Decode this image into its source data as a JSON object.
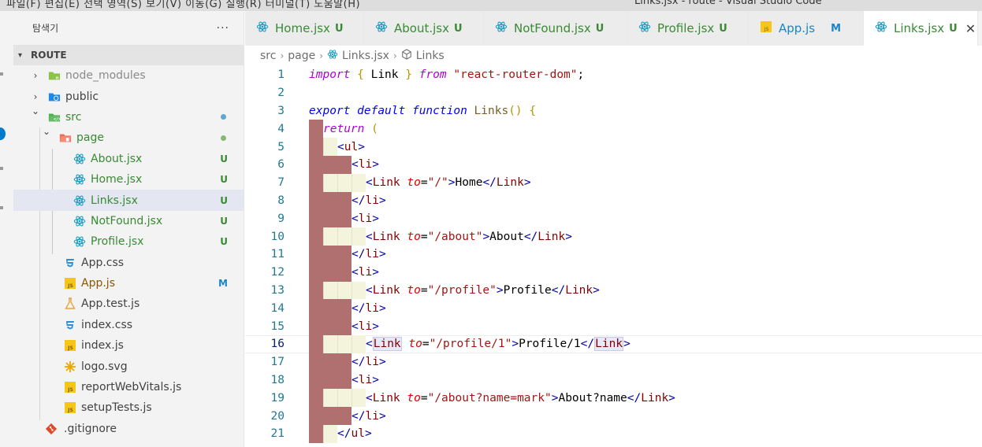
{
  "menubar": {
    "items_text": "파일(F)   편집(E)   선택 영역(S)   보기(V)   이동(G)   실행(R)   터미널(T)   도움말(H)",
    "window_title": "Links.jsx - route - Visual Studio Code"
  },
  "sidebar": {
    "title": "탐색기",
    "more": "···",
    "section": "ROUTE",
    "tree": [
      {
        "label": "node_modules",
        "depth": 1,
        "kind": "folder",
        "chevron": "›",
        "icon": "folder-node",
        "color": "gray"
      },
      {
        "label": "public",
        "depth": 1,
        "kind": "folder",
        "chevron": "›",
        "icon": "folder-public",
        "color": "default"
      },
      {
        "label": "src",
        "depth": 1,
        "kind": "folder-open",
        "chevron": "⌄",
        "icon": "folder-src",
        "color": "green",
        "badge_dot": "#5fa8d3"
      },
      {
        "label": "page",
        "depth": 2,
        "kind": "folder-open",
        "chevron": "⌄",
        "icon": "folder-page",
        "color": "green",
        "badge_dot": "#88b86f"
      },
      {
        "label": "About.jsx",
        "depth": 3,
        "kind": "file",
        "icon": "react",
        "color": "green",
        "badge": "U"
      },
      {
        "label": "Home.jsx",
        "depth": 3,
        "kind": "file",
        "icon": "react",
        "color": "green",
        "badge": "U"
      },
      {
        "label": "Links.jsx",
        "depth": 3,
        "kind": "file",
        "icon": "react",
        "color": "green",
        "badge": "U",
        "selected": true
      },
      {
        "label": "NotFound.jsx",
        "depth": 3,
        "kind": "file",
        "icon": "react",
        "color": "green",
        "badge": "U"
      },
      {
        "label": "Profile.jsx",
        "depth": 3,
        "kind": "file",
        "icon": "react",
        "color": "green",
        "badge": "U"
      },
      {
        "label": "App.css",
        "depth": 2,
        "kind": "file",
        "icon": "css",
        "color": "default"
      },
      {
        "label": "App.js",
        "depth": 2,
        "kind": "file",
        "icon": "js",
        "color": "modified",
        "badge": "M"
      },
      {
        "label": "App.test.js",
        "depth": 2,
        "kind": "file",
        "icon": "test",
        "color": "default"
      },
      {
        "label": "index.css",
        "depth": 2,
        "kind": "file",
        "icon": "css",
        "color": "default"
      },
      {
        "label": "index.js",
        "depth": 2,
        "kind": "file",
        "icon": "js",
        "color": "default"
      },
      {
        "label": "logo.svg",
        "depth": 2,
        "kind": "file",
        "icon": "svg",
        "color": "default"
      },
      {
        "label": "reportWebVitals.js",
        "depth": 2,
        "kind": "file",
        "icon": "js",
        "color": "default"
      },
      {
        "label": "setupTests.js",
        "depth": 2,
        "kind": "file",
        "icon": "js",
        "color": "default"
      },
      {
        "label": ".gitignore",
        "depth": 1,
        "kind": "file",
        "icon": "git",
        "color": "default"
      }
    ]
  },
  "tabs": [
    {
      "label": "Home.jsx",
      "badge": "U",
      "icon": "react"
    },
    {
      "label": "About.jsx",
      "badge": "U",
      "icon": "react"
    },
    {
      "label": "NotFound.jsx",
      "badge": "U",
      "icon": "react"
    },
    {
      "label": "Profile.jsx",
      "badge": "U",
      "icon": "react"
    },
    {
      "label": "App.js",
      "badge": "M",
      "icon": "js"
    },
    {
      "label": "Links.jsx",
      "badge": "U",
      "icon": "react",
      "active": true,
      "close": "✕"
    }
  ],
  "breadcrumb": [
    "src",
    "page",
    "Links.jsx",
    "Links"
  ],
  "editor": {
    "current_line": 16,
    "lines": [
      {
        "n": "1",
        "tokens": [
          [
            "kw2",
            "import"
          ],
          [
            "plain",
            " "
          ],
          [
            "brace",
            "{"
          ],
          [
            "plain",
            " Link "
          ],
          [
            "brace",
            "}"
          ],
          [
            "plain",
            " "
          ],
          [
            "kw2",
            "from"
          ],
          [
            "plain",
            " "
          ],
          [
            "str",
            "\"react-router-dom\""
          ],
          [
            "plain",
            ";"
          ]
        ]
      },
      {
        "n": "2",
        "tokens": []
      },
      {
        "n": "3",
        "tokens": [
          [
            "kw",
            "export"
          ],
          [
            "plain",
            " "
          ],
          [
            "kw",
            "default"
          ],
          [
            "plain",
            " "
          ],
          [
            "kw",
            "function"
          ],
          [
            "plain",
            " "
          ],
          [
            "fn",
            "Links"
          ],
          [
            "brace",
            "()"
          ],
          [
            "plain",
            " "
          ],
          [
            "brace",
            "{"
          ]
        ]
      },
      {
        "n": "4",
        "indent": 1,
        "tokens": [
          [
            "kw2",
            "return"
          ],
          [
            "plain",
            " "
          ],
          [
            "brace",
            "("
          ]
        ]
      },
      {
        "n": "5",
        "indent": 2,
        "tokens": [
          [
            "tagbr",
            "<"
          ],
          [
            "tag",
            "ul"
          ],
          [
            "tagbr",
            ">"
          ]
        ]
      },
      {
        "n": "6",
        "indent": 3,
        "tokens": [
          [
            "tagbr",
            "<"
          ],
          [
            "tag",
            "li"
          ],
          [
            "tagbr",
            ">"
          ]
        ]
      },
      {
        "n": "7",
        "indent": 4,
        "tokens": [
          [
            "tagbr",
            "<"
          ],
          [
            "tag",
            "Link"
          ],
          [
            "plain",
            " "
          ],
          [
            "attr",
            "to"
          ],
          [
            "plain",
            "="
          ],
          [
            "str",
            "\"/\""
          ],
          [
            "tagbr",
            ">"
          ],
          [
            "plain",
            "Home"
          ],
          [
            "tagbr",
            "</"
          ],
          [
            "tag",
            "Link"
          ],
          [
            "tagbr",
            ">"
          ]
        ]
      },
      {
        "n": "8",
        "indent": 3,
        "tokens": [
          [
            "tagbr",
            "</"
          ],
          [
            "tag",
            "li"
          ],
          [
            "tagbr",
            ">"
          ]
        ]
      },
      {
        "n": "9",
        "indent": 3,
        "tokens": [
          [
            "tagbr",
            "<"
          ],
          [
            "tag",
            "li"
          ],
          [
            "tagbr",
            ">"
          ]
        ]
      },
      {
        "n": "10",
        "indent": 4,
        "tokens": [
          [
            "tagbr",
            "<"
          ],
          [
            "tag",
            "Link"
          ],
          [
            "plain",
            " "
          ],
          [
            "attr",
            "to"
          ],
          [
            "plain",
            "="
          ],
          [
            "str",
            "\"/about\""
          ],
          [
            "tagbr",
            ">"
          ],
          [
            "plain",
            "About"
          ],
          [
            "tagbr",
            "</"
          ],
          [
            "tag",
            "Link"
          ],
          [
            "tagbr",
            ">"
          ]
        ]
      },
      {
        "n": "11",
        "indent": 3,
        "tokens": [
          [
            "tagbr",
            "</"
          ],
          [
            "tag",
            "li"
          ],
          [
            "tagbr",
            ">"
          ]
        ]
      },
      {
        "n": "12",
        "indent": 3,
        "tokens": [
          [
            "tagbr",
            "<"
          ],
          [
            "tag",
            "li"
          ],
          [
            "tagbr",
            ">"
          ]
        ]
      },
      {
        "n": "13",
        "indent": 4,
        "tokens": [
          [
            "tagbr",
            "<"
          ],
          [
            "tag",
            "Link"
          ],
          [
            "plain",
            " "
          ],
          [
            "attr",
            "to"
          ],
          [
            "plain",
            "="
          ],
          [
            "str",
            "\"/profile\""
          ],
          [
            "tagbr",
            ">"
          ],
          [
            "plain",
            "Profile"
          ],
          [
            "tagbr",
            "</"
          ],
          [
            "tag",
            "Link"
          ],
          [
            "tagbr",
            ">"
          ]
        ]
      },
      {
        "n": "14",
        "indent": 3,
        "tokens": [
          [
            "tagbr",
            "</"
          ],
          [
            "tag",
            "li"
          ],
          [
            "tagbr",
            ">"
          ]
        ]
      },
      {
        "n": "15",
        "indent": 3,
        "tokens": [
          [
            "tagbr",
            "<"
          ],
          [
            "tag",
            "li"
          ],
          [
            "tagbr",
            ">"
          ]
        ]
      },
      {
        "n": "16",
        "indent": 4,
        "tokens": [
          [
            "tagbr",
            "<"
          ],
          [
            "tag",
            "Link"
          ],
          [
            "plain",
            " "
          ],
          [
            "attr",
            "to"
          ],
          [
            "plain",
            "="
          ],
          [
            "str",
            "\"/profile/1\""
          ],
          [
            "tagbr",
            ">"
          ],
          [
            "plain",
            "Profile/1"
          ],
          [
            "tagbr",
            "</"
          ],
          [
            "tag",
            "Link"
          ],
          [
            "tagbr",
            ">"
          ]
        ]
      },
      {
        "n": "17",
        "indent": 3,
        "tokens": [
          [
            "tagbr",
            "</"
          ],
          [
            "tag",
            "li"
          ],
          [
            "tagbr",
            ">"
          ]
        ]
      },
      {
        "n": "18",
        "indent": 3,
        "tokens": [
          [
            "tagbr",
            "<"
          ],
          [
            "tag",
            "li"
          ],
          [
            "tagbr",
            ">"
          ]
        ]
      },
      {
        "n": "19",
        "indent": 4,
        "tokens": [
          [
            "tagbr",
            "<"
          ],
          [
            "tag",
            "Link"
          ],
          [
            "plain",
            " "
          ],
          [
            "attr",
            "to"
          ],
          [
            "plain",
            "="
          ],
          [
            "str",
            "\"/about?name=mark\""
          ],
          [
            "tagbr",
            ">"
          ],
          [
            "plain",
            "About?name"
          ],
          [
            "tagbr",
            "</"
          ],
          [
            "tag",
            "Link"
          ],
          [
            "tagbr",
            ">"
          ]
        ]
      },
      {
        "n": "20",
        "indent": 3,
        "tokens": [
          [
            "tagbr",
            "</"
          ],
          [
            "tag",
            "li"
          ],
          [
            "tagbr",
            ">"
          ]
        ]
      },
      {
        "n": "21",
        "indent": 2,
        "tokens": [
          [
            "tagbr",
            "</"
          ],
          [
            "tag",
            "ul"
          ],
          [
            "tagbr",
            ">"
          ]
        ]
      }
    ]
  },
  "colors": {
    "indent_error": "#b07070",
    "indent_light": "#f4f4dc",
    "accent": "#007acc"
  }
}
